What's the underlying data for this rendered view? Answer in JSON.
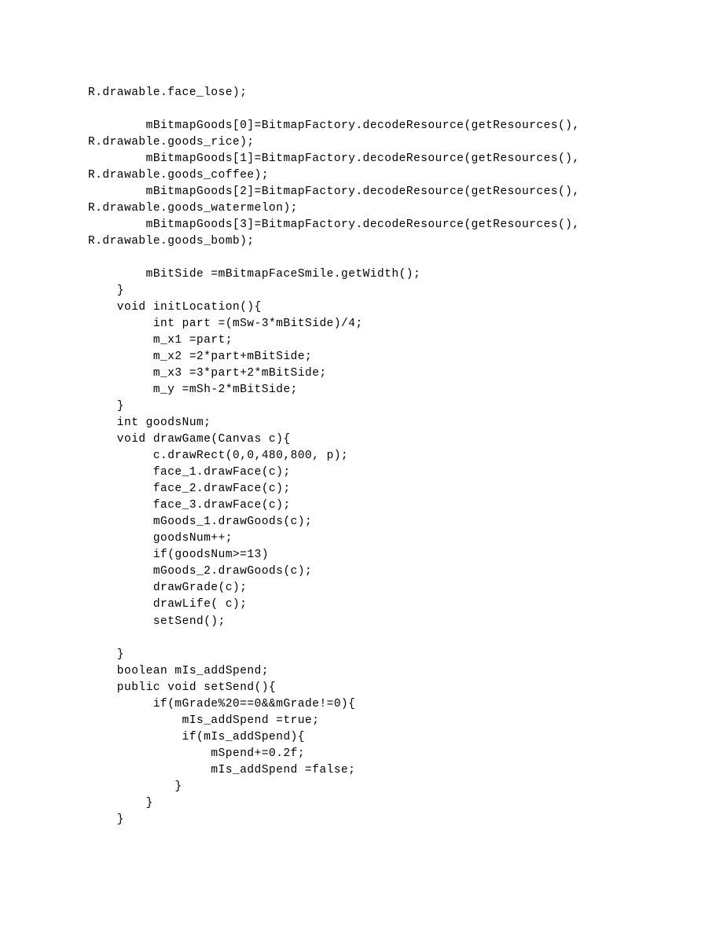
{
  "code": "R.drawable.face_lose);\n\n        mBitmapGoods[0]=BitmapFactory.decodeResource(getResources(),\nR.drawable.goods_rice);\n        mBitmapGoods[1]=BitmapFactory.decodeResource(getResources(),\nR.drawable.goods_coffee);\n        mBitmapGoods[2]=BitmapFactory.decodeResource(getResources(),\nR.drawable.goods_watermelon);\n        mBitmapGoods[3]=BitmapFactory.decodeResource(getResources(),\nR.drawable.goods_bomb);\n\n        mBitSide =mBitmapFaceSmile.getWidth();\n    }\n    void initLocation(){\n         int part =(mSw-3*mBitSide)/4;\n         m_x1 =part;\n         m_x2 =2*part+mBitSide;\n         m_x3 =3*part+2*mBitSide;\n         m_y =mSh-2*mBitSide;\n    }\n    int goodsNum;\n    void drawGame(Canvas c){\n         c.drawRect(0,0,480,800, p);\n         face_1.drawFace(c);\n         face_2.drawFace(c);\n         face_3.drawFace(c);\n         mGoods_1.drawGoods(c);\n         goodsNum++;\n         if(goodsNum>=13)\n         mGoods_2.drawGoods(c);\n         drawGrade(c);\n         drawLife( c);\n         setSend();\n\n    }\n    boolean mIs_addSpend;\n    public void setSend(){\n         if(mGrade%20==0&&mGrade!=0){\n             mIs_addSpend =true;\n             if(mIs_addSpend){\n                 mSpend+=0.2f;\n                 mIs_addSpend =false;\n            }\n        }\n    }"
}
